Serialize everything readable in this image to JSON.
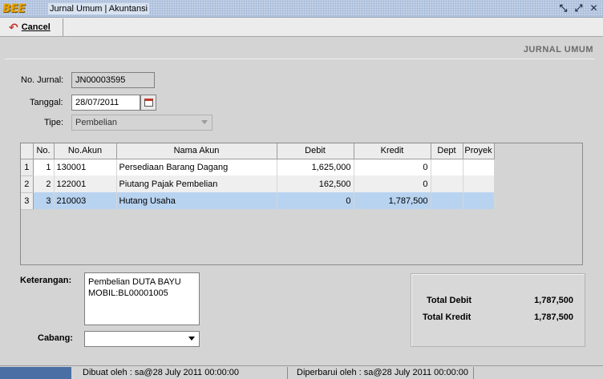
{
  "window": {
    "logo": "BEE",
    "title": "Jurnal Umum | Akuntansi",
    "buttons": {
      "restore": "⤡",
      "maximize": "⤢",
      "close": "✕"
    }
  },
  "toolbar": {
    "cancel_label": "Cancel",
    "cancel_icon": "undo-arrow-icon"
  },
  "section_title": "JURNAL UMUM",
  "form": {
    "no_jurnal_label": "No. Jurnal:",
    "no_jurnal_value": "JN00003595",
    "tanggal_label": "Tanggal:",
    "tanggal_value": "28/07/2011",
    "tipe_label": "Tipe:",
    "tipe_value": "Pembelian"
  },
  "grid": {
    "columns": [
      "No.",
      "No.Akun",
      "Nama Akun",
      "Debit",
      "Kredit",
      "Dept",
      "Proyek"
    ],
    "rows": [
      {
        "row_num": "1",
        "no": "1",
        "no_akun": "130001",
        "nama_akun": "Persediaan Barang Dagang",
        "debit": "1,625,000",
        "kredit": "0",
        "dept": "",
        "proyek": ""
      },
      {
        "row_num": "2",
        "no": "2",
        "no_akun": "122001",
        "nama_akun": "Piutang Pajak Pembelian",
        "debit": "162,500",
        "kredit": "0",
        "dept": "",
        "proyek": ""
      },
      {
        "row_num": "3",
        "no": "3",
        "no_akun": "210003",
        "nama_akun": "Hutang Usaha",
        "debit": "0",
        "kredit": "1,787,500",
        "dept": "",
        "proyek": ""
      }
    ],
    "selected_row": 3
  },
  "keterangan": {
    "label": "Keterangan:",
    "line1": "Pembelian DUTA BAYU",
    "line2": "MOBIL:BL00001005"
  },
  "cabang": {
    "label": "Cabang:",
    "value": ""
  },
  "totals": {
    "debit_label": "Total Debit",
    "debit_value": "1,787,500",
    "kredit_label": "Total Kredit",
    "kredit_value": "1,787,500"
  },
  "status": {
    "created": "Dibuat oleh : sa@28 July 2011  00:00:00",
    "updated": "Diperbarui oleh : sa@28 July 2011  00:00:00"
  },
  "colors": {
    "selection": "#b8d3f0",
    "status_accent": "#4a6fa5"
  }
}
